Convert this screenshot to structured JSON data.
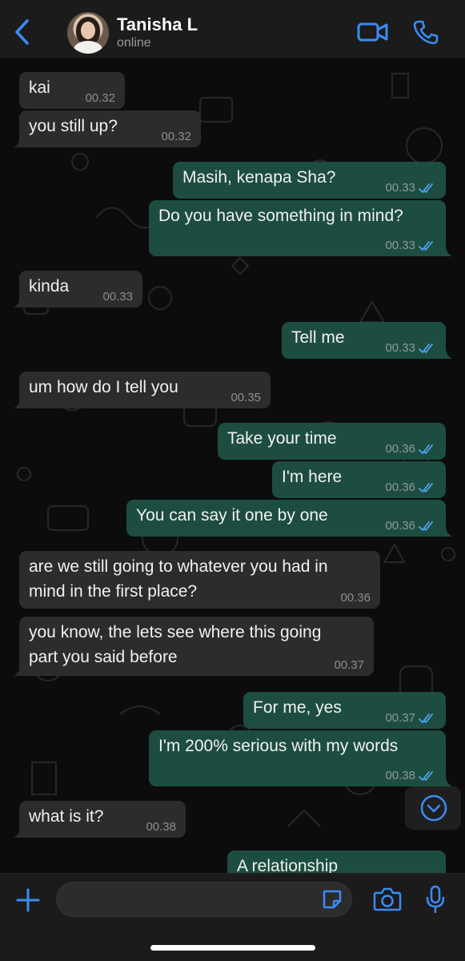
{
  "header": {
    "contact_name": "Tanisha L",
    "status": "online",
    "accent_color": "#3b8cf5"
  },
  "messages": [
    {
      "dir": "in",
      "text": "kai",
      "time": "00.32"
    },
    {
      "dir": "in",
      "text": "you still up?",
      "time": "00.32"
    },
    {
      "dir": "out",
      "text": "Masih, kenapa Sha?",
      "time": "00.33"
    },
    {
      "dir": "out",
      "text": "Do you have something in mind?",
      "time": "00.33"
    },
    {
      "dir": "in",
      "text": "kinda",
      "time": "00.33"
    },
    {
      "dir": "out",
      "text": "Tell me",
      "time": "00.33"
    },
    {
      "dir": "in",
      "text": "um how do I tell you",
      "time": "00.35"
    },
    {
      "dir": "out",
      "text": "Take your time",
      "time": "00.36"
    },
    {
      "dir": "out",
      "text": "I'm here",
      "time": "00.36"
    },
    {
      "dir": "out",
      "text": "You can say it one by one",
      "time": "00.36"
    },
    {
      "dir": "in",
      "text": "are we still going to whatever you had in\nmind in the first place?",
      "time": "00.36"
    },
    {
      "dir": "in",
      "text": "you know, the lets see where this going\npart you said before",
      "time": "00.37"
    },
    {
      "dir": "out",
      "text": "For me, yes",
      "time": "00.37"
    },
    {
      "dir": "out",
      "text": "I'm 200% serious with my words",
      "time": "00.38"
    },
    {
      "dir": "in",
      "text": "what is it?",
      "time": "00.38"
    },
    {
      "dir": "out",
      "text": "A relationship",
      "time": ""
    }
  ],
  "composer": {
    "placeholder": ""
  },
  "icons": {
    "back": "chevron-left-icon",
    "video": "video-camera-icon",
    "call": "phone-icon",
    "plus": "plus-icon",
    "sticker": "sticker-icon",
    "camera": "camera-icon",
    "mic": "microphone-icon",
    "scroll": "chevron-down-circle-icon"
  }
}
